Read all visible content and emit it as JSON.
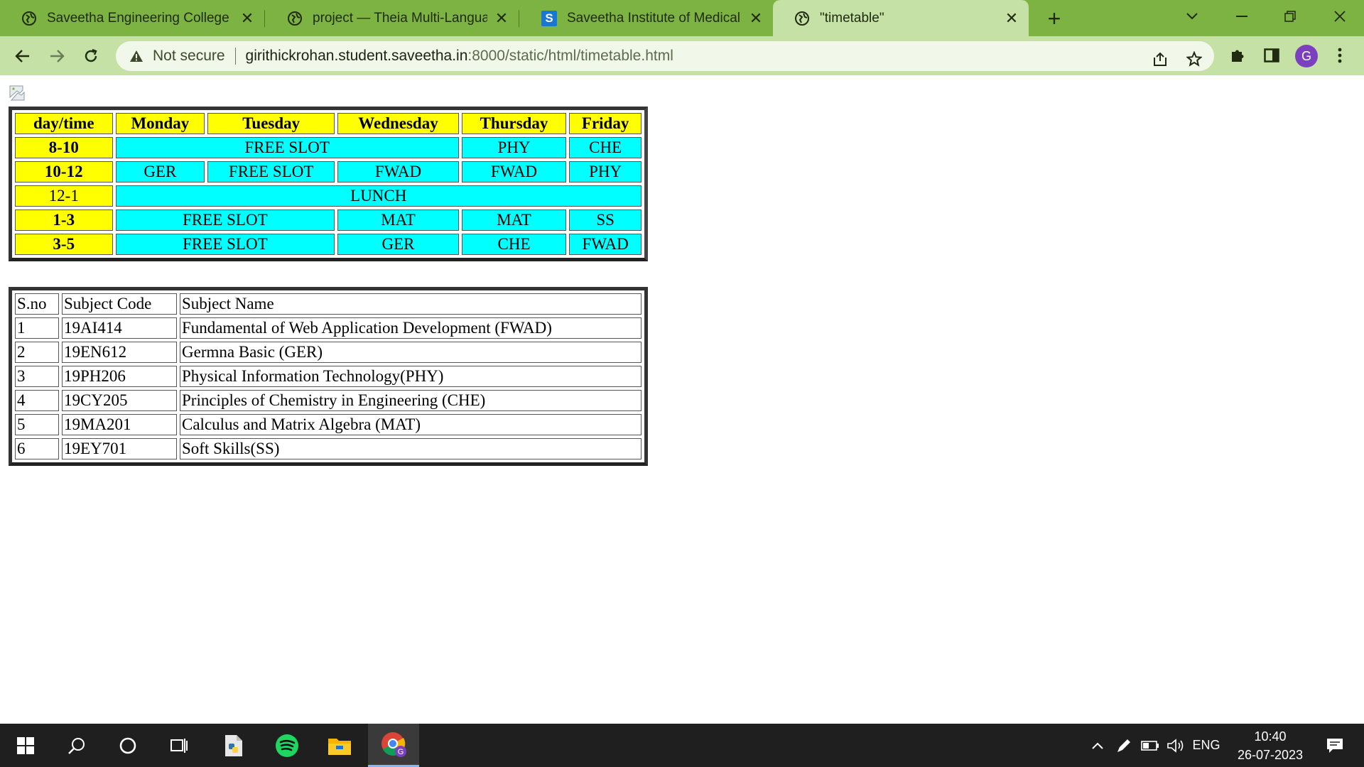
{
  "browser": {
    "tabs": [
      {
        "title": "Saveetha Engineering College",
        "icon": "globe-icon",
        "active": false
      },
      {
        "title": "project — Theia Multi-Language",
        "icon": "globe-icon",
        "active": false
      },
      {
        "title": "Saveetha Institute of Medical An",
        "icon": "saveetha-s-icon",
        "active": false
      },
      {
        "title": "\"timetable\"",
        "icon": "globe-icon",
        "active": true
      }
    ],
    "address": {
      "security_label": "Not secure",
      "host": "girithickrohan.student.saveetha.in",
      "path": ":8000/static/html/timetable.html"
    },
    "profile_initial": "G",
    "theme_colors": {
      "tabbar": "#7cb342",
      "toolbar": "#c5e1a5",
      "avatar": "#7b3fbf"
    }
  },
  "timetable": {
    "headers": [
      "day/time",
      "Monday",
      "Tuesday",
      "Wednesday",
      "Thursday",
      "Friday"
    ],
    "rows": [
      {
        "time": "8-10",
        "cells": [
          "FREE SLOT",
          "PHY",
          "CHE"
        ]
      },
      {
        "time": "10-12",
        "cells": [
          "GER",
          "FREE SLOT",
          "FWAD",
          "FWAD",
          "PHY"
        ]
      },
      {
        "time": "12-1",
        "cells": [
          "LUNCH"
        ]
      },
      {
        "time": "1-3",
        "cells": [
          "FREE SLOT",
          "MAT",
          "MAT",
          "SS"
        ]
      },
      {
        "time": "3-5",
        "cells": [
          "FREE SLOT",
          "GER",
          "CHE",
          "FWAD"
        ]
      }
    ],
    "colors": {
      "header": "#ffff00",
      "slot": "#00ffff"
    }
  },
  "subjects": {
    "headers": [
      "S.no",
      "Subject Code",
      "Subject Name"
    ],
    "rows": [
      [
        "1",
        "19AI414",
        "Fundamental of Web Application Development (FWAD)"
      ],
      [
        "2",
        "19EN612",
        "Germna Basic (GER)"
      ],
      [
        "3",
        "19PH206",
        "Physical Information Technology(PHY)"
      ],
      [
        "4",
        "19CY205",
        "Principles of Chemistry in Engineering (CHE)"
      ],
      [
        "5",
        "19MA201",
        "Calculus and Matrix Algebra (MAT)"
      ],
      [
        "6",
        "19EY701",
        "Soft Skills(SS)"
      ]
    ]
  },
  "taskbar": {
    "language": "ENG",
    "time": "10:40",
    "date": "26-07-2023"
  }
}
